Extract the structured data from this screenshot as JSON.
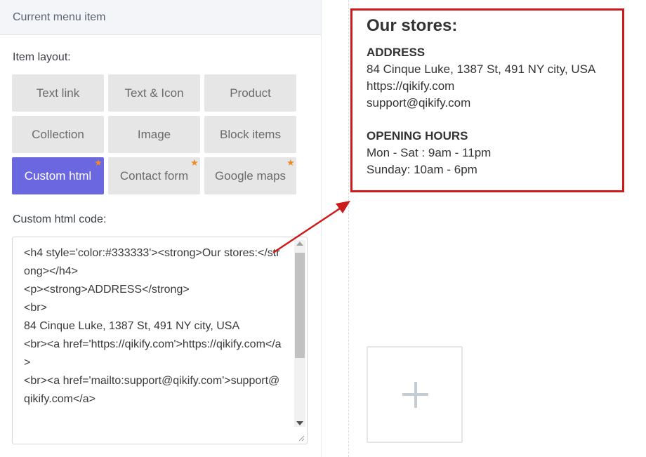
{
  "panel": {
    "header_title": "Current menu item",
    "item_layout_label": "Item layout:",
    "custom_html_label": "Custom html code:"
  },
  "layouts": [
    {
      "label": "Text link",
      "active": false,
      "starred": false
    },
    {
      "label": "Text & Icon",
      "active": false,
      "starred": false
    },
    {
      "label": "Product",
      "active": false,
      "starred": false
    },
    {
      "label": "Collection",
      "active": false,
      "starred": false
    },
    {
      "label": "Image",
      "active": false,
      "starred": false
    },
    {
      "label": "Block items",
      "active": false,
      "starred": false
    },
    {
      "label": "Custom html",
      "active": true,
      "starred": true
    },
    {
      "label": "Contact form",
      "active": false,
      "starred": true
    },
    {
      "label": "Google maps",
      "active": false,
      "starred": true
    }
  ],
  "code": {
    "value": "<h4 style='color:#333333'><strong>Our stores:</strong></h4>\n<p><strong>ADDRESS</strong>\n<br>\n84 Cinque Luke, 1387 St, 491 NY city, USA\n<br><a href='https://qikify.com'>https://qikify.com</a>\n<br><a href='mailto:support@qikify.com'>support@qikify.com</a>"
  },
  "preview": {
    "title": "Our stores:",
    "address_heading": "ADDRESS",
    "address_line": "84 Cinque Luke, 1387 St, 491 NY city, USA",
    "website": "https://qikify.com",
    "email": "support@qikify.com",
    "hours_heading": "OPENING HOURS",
    "hours_weekday": "Mon - Sat : 9am - 11pm",
    "hours_sunday": "Sunday: 10am - 6pm"
  },
  "colors": {
    "accent": "#6b67e0",
    "star": "#f08a24",
    "highlight": "#cc1b1b"
  },
  "icons": {
    "star": "star-icon",
    "add": "plus-icon",
    "arrow": "arrow-icon"
  }
}
